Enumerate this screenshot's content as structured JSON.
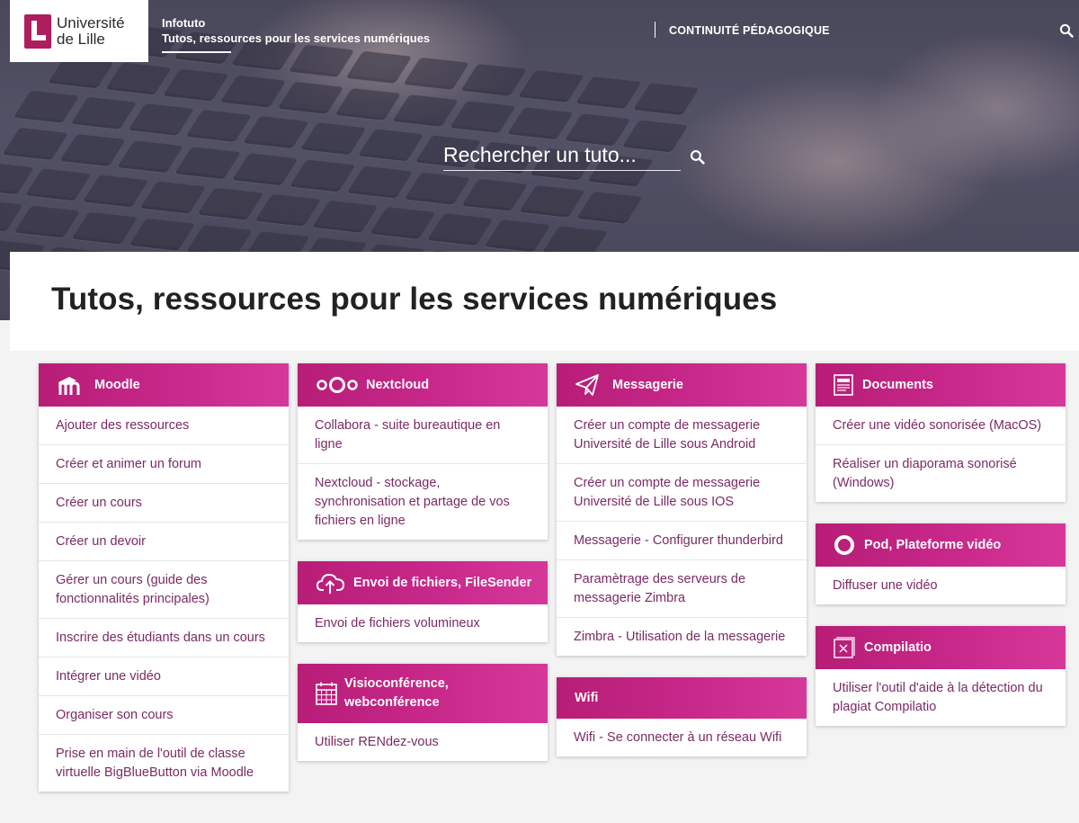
{
  "header": {
    "logo_line1": "Université",
    "logo_line2": "de Lille",
    "site_name": "Infotuto",
    "site_subtitle": "Tutos, ressources pour les services numériques",
    "nav_link": "CONTINUITÉ PÉDAGOGIQUE",
    "search_icon": "search-icon"
  },
  "hero": {
    "search_placeholder": "Rechercher un tuto..."
  },
  "main": {
    "title": "Tutos, ressources pour les services numériques"
  },
  "colors": {
    "brand": "#ae1e5c",
    "card_header": "#c8288a",
    "link": "#7c2a64"
  },
  "cards": {
    "moodle": {
      "icon": "moodle-icon",
      "title": "Moodle",
      "items": [
        "Ajouter des ressources",
        "Créer et animer un forum",
        "Créer un cours",
        "Créer un devoir",
        "Gérer un cours (guide des fonctionnalités principales)",
        "Inscrire des étudiants dans un cours",
        "Intégrer une vidéo",
        "Organiser son cours",
        "Prise en main de l'outil de classe virtuelle BigBlueButton via Moodle"
      ]
    },
    "nextcloud": {
      "icon": "nextcloud-icon",
      "title": "Nextcloud",
      "items": [
        "Collabora - suite bureautique en ligne",
        "Nextcloud - stockage, synchronisation et partage de vos fichiers en ligne"
      ]
    },
    "filesender": {
      "icon": "cloud-upload-icon",
      "title": "Envoi de fichiers, FileSender",
      "items": [
        "Envoi de fichiers volumineux"
      ]
    },
    "visio": {
      "icon": "calendar-icon",
      "title": "Visioconférence, webconférence",
      "items": [
        "Utiliser RENdez-vous"
      ]
    },
    "messagerie": {
      "icon": "paper-plane-icon",
      "title": "Messagerie",
      "items": [
        "Créer un compte de messagerie Université de Lille sous Android",
        "Créer un compte de messagerie Université de Lille sous IOS",
        "Messagerie - Configurer thunderbird",
        "Paramètrage des serveurs de messagerie Zimbra",
        "Zimbra - Utilisation de la messagerie"
      ]
    },
    "wifi": {
      "title": "Wifi",
      "items": [
        "Wifi - Se connecter à un réseau Wifi"
      ]
    },
    "documents": {
      "icon": "document-icon",
      "title": "Documents",
      "items": [
        "Créer une vidéo sonorisée (MacOS)",
        "Réaliser un diaporama sonorisé (Windows)"
      ]
    },
    "pod": {
      "icon": "circle-icon",
      "title": "Pod, Plateforme vidéo",
      "items": [
        "Diffuser une vidéo"
      ]
    },
    "compilatio": {
      "icon": "compilatio-icon",
      "title": "Compilatio",
      "items": [
        "Utiliser l'outil d'aide à la détection du plagiat Compilatio"
      ]
    }
  }
}
